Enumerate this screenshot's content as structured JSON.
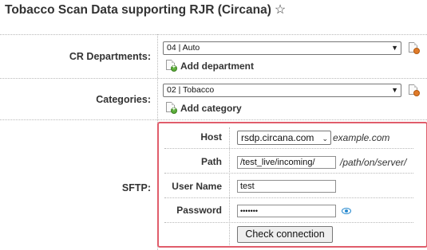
{
  "page_title": "Tobacco Scan Data supporting RJR (Circana)",
  "star_glyph": "☆",
  "cr_departments": {
    "label": "CR Departments:",
    "selected": "04 | Auto",
    "add_label": "Add department"
  },
  "categories": {
    "label": "Categories:",
    "selected": "02 | Tobacco",
    "add_label": "Add category"
  },
  "sftp": {
    "label": "SFTP:",
    "host": {
      "label": "Host",
      "value": "rsdp.circana.com",
      "hint": "example.com"
    },
    "path": {
      "label": "Path",
      "value": "/test_live/incoming/",
      "hint": "/path/on/server/"
    },
    "username": {
      "label": "User Name",
      "value": "test"
    },
    "password": {
      "label": "Password",
      "value": "•••••••"
    },
    "check_button": "Check connection"
  },
  "colors": {
    "highlight_border": "#e05d6b",
    "eye_icon": "#2a8bd0"
  }
}
